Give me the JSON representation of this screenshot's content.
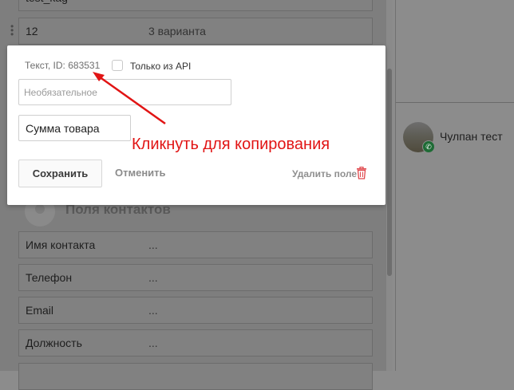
{
  "background_rows": [
    {
      "label": "test_kag",
      "value": ""
    },
    {
      "label": "12",
      "value": "3 варианта"
    }
  ],
  "section": {
    "title": "Поля контактов"
  },
  "contact_rows": [
    {
      "label": "Имя контакта",
      "value": "..."
    },
    {
      "label": "Телефон",
      "value": "..."
    },
    {
      "label": "Email",
      "value": "..."
    },
    {
      "label": "Должность",
      "value": "..."
    }
  ],
  "right_panel": {
    "contact_name": "Чулпан тест",
    "badge_icon": "whatsapp-icon"
  },
  "modal": {
    "field_meta": "Текст, ID: 683531",
    "api_only_label": "Только из API",
    "api_only_checked": false,
    "placeholder_input": "Необязательное",
    "name_value": "Сумма товара",
    "save_label": "Сохранить",
    "cancel_label": "Отменить",
    "delete_label": "Удалить поле"
  },
  "annotation": {
    "text": "Кликнуть для копирования",
    "color": "#e11414"
  },
  "colors": {
    "accent_red": "#e11414",
    "overlay": "#7e7e7e"
  }
}
